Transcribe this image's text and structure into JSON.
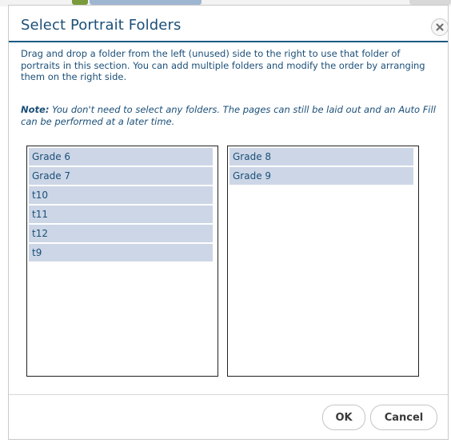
{
  "dialog": {
    "title": "Select Portrait Folders",
    "close_icon": "close-x-icon",
    "description": "Drag and drop a folder from the left (unused) side to the right to use that folder of portraits in this section. You can add multiple folders and modify the order by arranging them on the right side.",
    "note_label": "Note:",
    "note_text": " You don't need to select any folders. The pages can still be laid out and an Auto Fill can be performed at a later time."
  },
  "unused_folders": [
    "Grade 6",
    "Grade 7",
    "t10",
    "t11",
    "t12",
    "t9"
  ],
  "selected_folders": [
    "Grade 8",
    "Grade 9"
  ],
  "buttons": {
    "ok_label": "OK",
    "cancel_label": "Cancel"
  },
  "colors": {
    "title": "#1b4f78",
    "accent_rule": "#1d5a84",
    "item_background": "#ccd6e6"
  }
}
